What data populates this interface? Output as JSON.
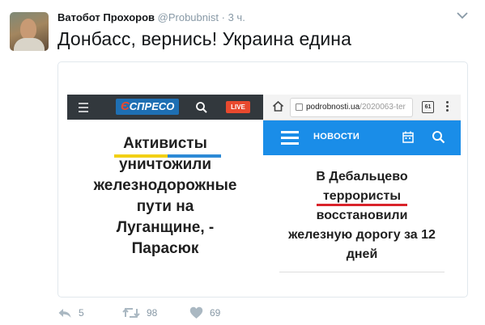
{
  "tweet": {
    "author_name": "Ватобот Прохоров",
    "author_handle": "@Probubnist",
    "separator": "·",
    "time": "3 ч.",
    "text": "Донбасс, вернись! Украина едина",
    "actions": {
      "reply_count": "5",
      "retweet_count": "98",
      "like_count": "69"
    }
  },
  "media": {
    "left": {
      "logo_e": "Є",
      "logo_text": "СПРЕСО",
      "live_label": "LIVE",
      "headline_lines": [
        "Активисты",
        "уничтожили",
        "железнодорожные",
        "пути на",
        "Луганщине, -",
        "Парасюк"
      ],
      "underline_colors": [
        "#f2d015",
        "#2d8ad6"
      ]
    },
    "right": {
      "url_host": "podrobnosti.ua",
      "url_path": "/2020063-ter",
      "tabs_count": "61",
      "nav_label": "НОВОСТИ",
      "headline_lines": [
        "В Дебальцево",
        "террористы",
        "восстановили",
        "железную дорогу за 12",
        "дней"
      ],
      "accent_color": "#1a8de8",
      "underline_color": "#d9232a"
    }
  },
  "icons": [
    "avatar",
    "chevron-down-icon",
    "menu-icon",
    "search-icon",
    "home-icon",
    "lock-icon",
    "tabs-icon",
    "more-vert-icon",
    "calendar-icon",
    "reply-icon",
    "retweet-icon",
    "like-icon"
  ]
}
